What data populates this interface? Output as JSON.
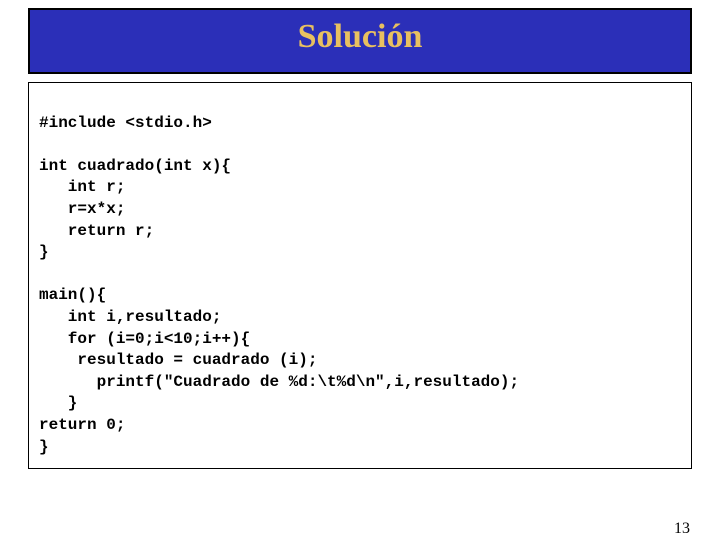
{
  "header": {
    "title": "Solución"
  },
  "code": {
    "line1": "#include <stdio.h>",
    "line2": "",
    "line3": "int cuadrado(int x){",
    "line4": "   int r;",
    "line5": "   r=x*x;",
    "line6": "   return r;",
    "line7": "}",
    "line8": "",
    "line9": "main(){",
    "line10": "   int i,resultado;",
    "line11": "   for (i=0;i<10;i++){",
    "line12": "    resultado = cuadrado (i);",
    "line13": "      printf(\"Cuadrado de %d:\\t%d\\n\",i,resultado);",
    "line14": "   }",
    "line15": "return 0;",
    "line16": "}"
  },
  "page_number": "13"
}
